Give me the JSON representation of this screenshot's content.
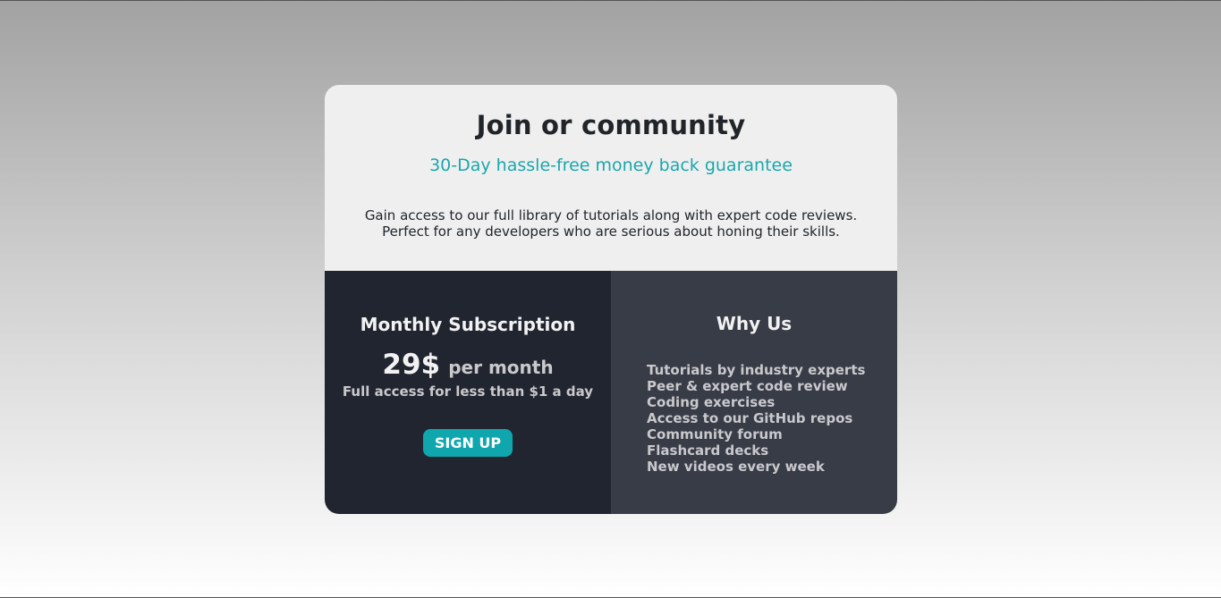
{
  "header": {
    "title": "Join or community",
    "subtitle": "30-Day hassle-free money back guarantee",
    "description_line1": "Gain access to our full library of tutorials along with expert code reviews.",
    "description_line2": "Perfect for any developers who are serious about honing their skills."
  },
  "subscription": {
    "heading": "Monthly Subscription",
    "price": "29$",
    "period": "per month",
    "note": "Full access for less than $1 a day",
    "button_label": "SIGN UP"
  },
  "why_us": {
    "heading": "Why Us",
    "items": [
      "Tutorials by industry experts",
      "Peer & expert code review",
      "Coding exercises",
      "Access to our GitHub repos",
      "Community forum",
      "Flashcard decks",
      "New videos every week"
    ]
  },
  "colors": {
    "accent": "#0fa6ad",
    "card_top": "#efefef",
    "left_panel": "#212530",
    "right_panel": "#383c47"
  }
}
